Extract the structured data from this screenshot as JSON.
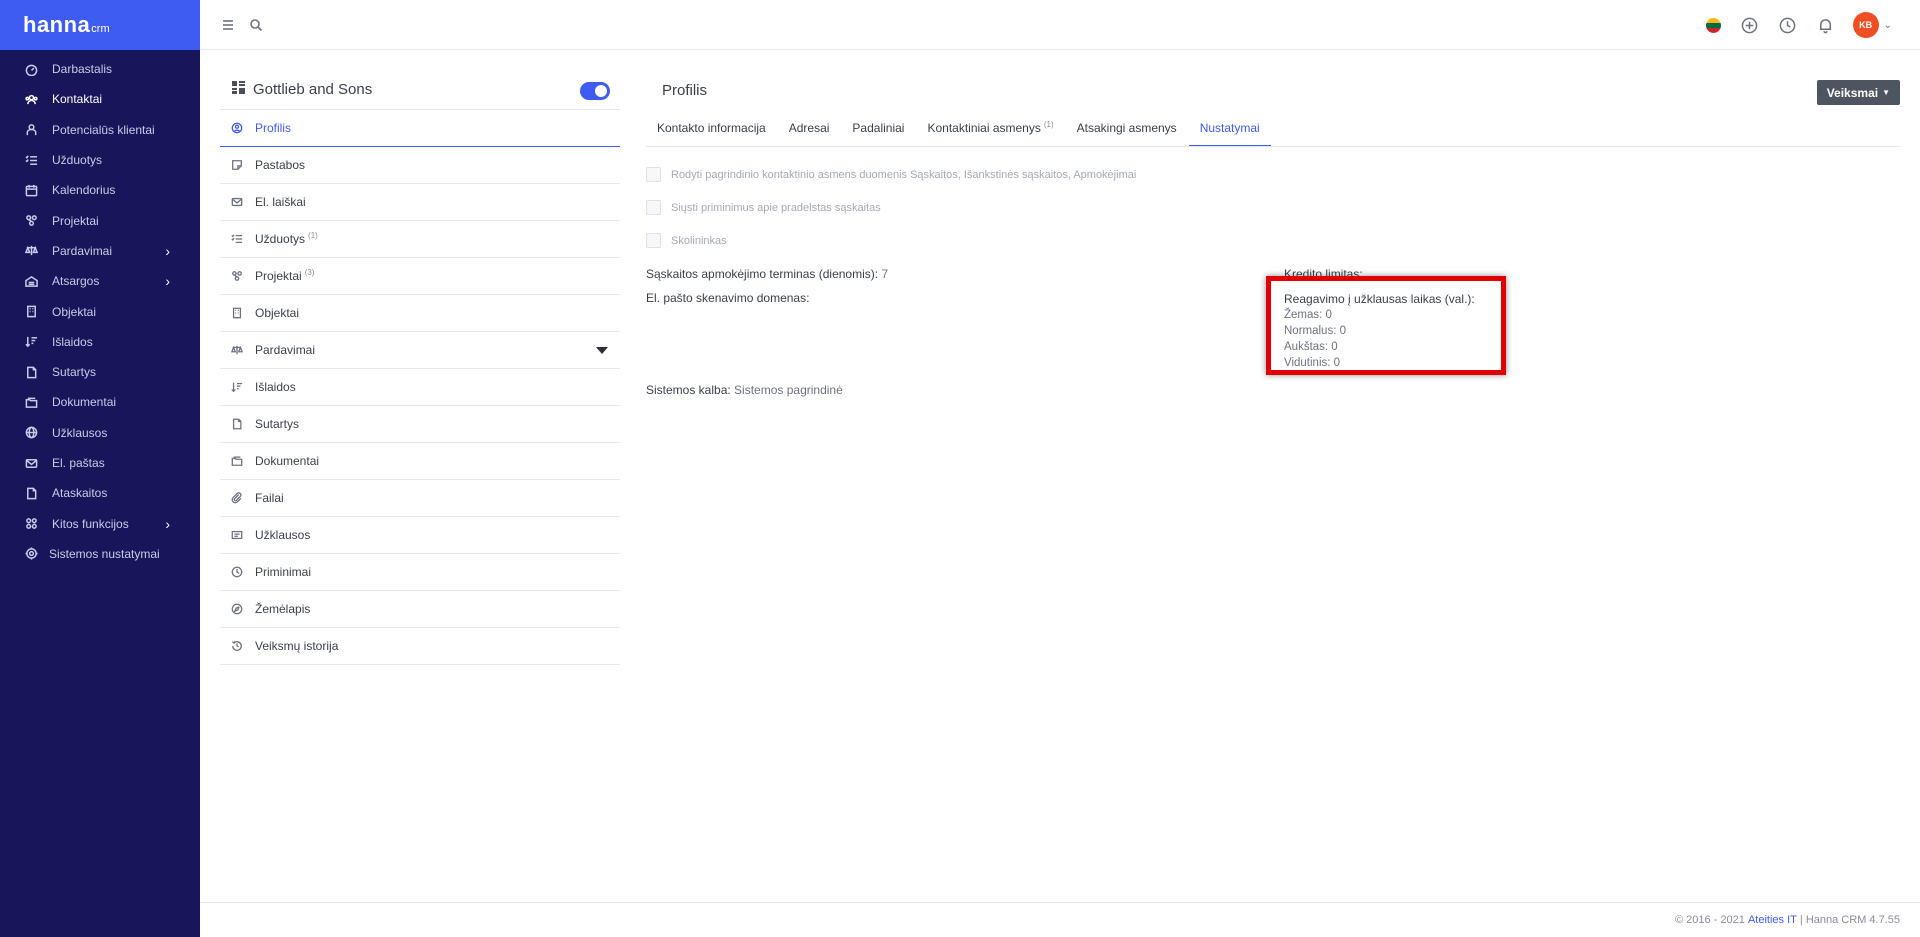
{
  "brand": {
    "name": "hanna",
    "suffix": "crm",
    "color": "#3f5cf2"
  },
  "sidebar": {
    "items": [
      {
        "label": "Darbastalis",
        "icon": "dashboard-icon"
      },
      {
        "label": "Kontaktai",
        "icon": "contacts-icon",
        "active": true
      },
      {
        "label": "Potencialūs klientai",
        "icon": "leads-icon"
      },
      {
        "label": "Užduotys",
        "icon": "tasks-icon"
      },
      {
        "label": "Kalendorius",
        "icon": "calendar-icon"
      },
      {
        "label": "Projektai",
        "icon": "projects-icon"
      },
      {
        "label": "Pardavimai",
        "icon": "sales-icon",
        "has_children": true
      },
      {
        "label": "Atsargos",
        "icon": "inventory-icon",
        "has_children": true
      },
      {
        "label": "Objektai",
        "icon": "building-icon"
      },
      {
        "label": "Išlaidos",
        "icon": "expenses-icon"
      },
      {
        "label": "Sutartys",
        "icon": "contract-icon"
      },
      {
        "label": "Dokumentai",
        "icon": "documents-icon"
      },
      {
        "label": "Užklausos",
        "icon": "globe-icon"
      },
      {
        "label": "El. paštas",
        "icon": "mail-icon"
      },
      {
        "label": "Ataskaitos",
        "icon": "reports-icon"
      },
      {
        "label": "Kitos funkcijos",
        "icon": "functions-icon",
        "has_children": true
      },
      {
        "label": "Sistemos nustatymai",
        "icon": "gear-icon"
      }
    ]
  },
  "topbar": {
    "avatar_initials": "KB",
    "flag_colors": [
      "#fdb913",
      "#006a44",
      "#c1272d"
    ]
  },
  "profile": {
    "company_name": "Gottlieb and Sons",
    "menu": [
      {
        "label": "Profilis",
        "icon": "user-icon",
        "active": true
      },
      {
        "label": "Pastabos",
        "icon": "notes-icon"
      },
      {
        "label": "El. laiškai",
        "icon": "mail-icon"
      },
      {
        "label": "Užduotys",
        "icon": "tasks-icon",
        "count": "(1)"
      },
      {
        "label": "Projektai",
        "icon": "projects-icon",
        "count": "(3)"
      },
      {
        "label": "Objektai",
        "icon": "building-icon"
      },
      {
        "label": "Pardavimai",
        "icon": "sales-icon",
        "dropdown": true
      },
      {
        "label": "Išlaidos",
        "icon": "expenses-icon"
      },
      {
        "label": "Sutartys",
        "icon": "contract-icon"
      },
      {
        "label": "Dokumentai",
        "icon": "documents-icon"
      },
      {
        "label": "Failai",
        "icon": "paperclip-icon"
      },
      {
        "label": "Užklausos",
        "icon": "inquiry-icon"
      },
      {
        "label": "Priminimai",
        "icon": "clock-icon"
      },
      {
        "label": "Žemėlapis",
        "icon": "map-icon"
      },
      {
        "label": "Veiksmų istorija",
        "icon": "history-icon"
      }
    ]
  },
  "main": {
    "title": "Profilis",
    "actions_label": "Veiksmai",
    "tabs": [
      {
        "label": "Kontakto informacija"
      },
      {
        "label": "Adresai"
      },
      {
        "label": "Padaliniai"
      },
      {
        "label": "Kontaktiniai asmenys",
        "count": "(1)"
      },
      {
        "label": "Atsakingi asmenys"
      },
      {
        "label": "Nustatymai",
        "active": true
      }
    ],
    "settings": {
      "checkboxes": [
        "Rodyti pagrindinio kontaktinio asmens duomenis Sąskaitos, Išankstinės sąskaitos, Apmokėjimai",
        "Siųsti priminimus apie pradelstas sąskaitas",
        "Skolininkas"
      ],
      "payment_term_label": "Sąskaitos apmokėjimo terminas (dienomis):",
      "payment_term_value": "7",
      "credit_limit_label": "Kredito limitas:",
      "email_domain_label": "El. pašto skenavimo domenas:",
      "response_label": "Reagavimo į užklausas laikas (val.):",
      "response_levels": [
        "Žemas: 0",
        "Normalus: 0",
        "Aukštas: 0",
        "Vidutinis: 0"
      ],
      "language_label": "Sistemos kalba:",
      "language_value": "Sistemos pagrindinė"
    }
  },
  "footer": {
    "copyright": "© 2016 - 2021",
    "company": "Ateities IT",
    "version": "| Hanna CRM 4.7.55"
  },
  "colors": {
    "sidebar_bg": "#18165a",
    "accent": "#3f5cf2",
    "highlight": "#e00000",
    "button_bg": "#4d5660"
  }
}
